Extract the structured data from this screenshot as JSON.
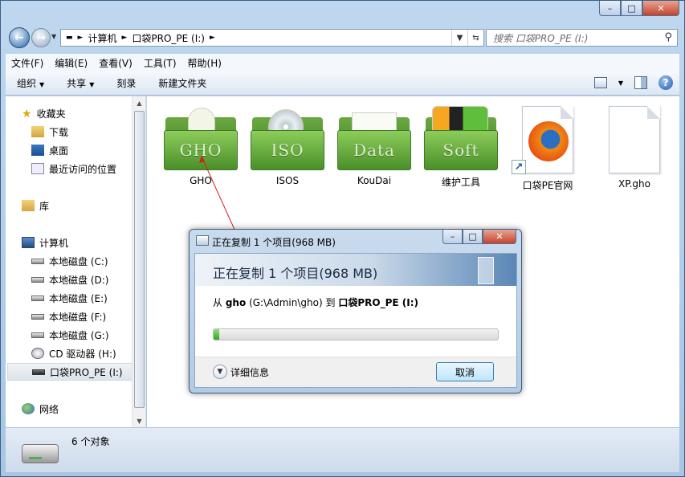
{
  "window": {
    "caption_buttons": [
      "–",
      "□",
      "✕"
    ]
  },
  "address": {
    "crumbs": [
      "计算机",
      "口袋PRO_PE (I:)"
    ],
    "search_placeholder": "搜索 口袋PRO_PE (I:)"
  },
  "menu": [
    "文件(F)",
    "编辑(E)",
    "查看(V)",
    "工具(T)",
    "帮助(H)"
  ],
  "toolbar": {
    "organize": "组织",
    "share": "共享",
    "burn": "刻录",
    "new_folder": "新建文件夹"
  },
  "nav": {
    "favorites": "收藏夹",
    "downloads": "下载",
    "desktop": "桌面",
    "recent": "最近访问的位置",
    "libraries": "库",
    "computer": "计算机",
    "drives": [
      "本地磁盘 (C:)",
      "本地磁盘 (D:)",
      "本地磁盘 (E:)",
      "本地磁盘 (F:)",
      "本地磁盘 (G:)",
      "CD 驱动器 (H:)",
      "口袋PRO_PE (I:)"
    ],
    "network": "网络"
  },
  "files": [
    {
      "name": "GHO",
      "front": "GHO"
    },
    {
      "name": "ISOS",
      "front": "ISO"
    },
    {
      "name": "KouDai",
      "front": "Data"
    },
    {
      "name": "维护工具",
      "front": "Soft"
    },
    {
      "name": "口袋PE官网"
    },
    {
      "name": "XP.gho"
    }
  ],
  "status": {
    "count": "6 个对象"
  },
  "dialog": {
    "title": "正在复制 1 个项目(968 MB)",
    "banner": "正在复制 1 个项目(968 MB)",
    "from_prefix": "从",
    "from_name": "gho",
    "from_path": "(G:\\Admin\\gho)",
    "to_word": "到",
    "to_name": "口袋PRO_PE (I:)",
    "progress": 0.02,
    "more_info": "详细信息",
    "cancel": "取消"
  },
  "colors": {
    "accent": "#3c7fb1",
    "progress_fill": "#2fa51b",
    "folder_green": "#4a8f29"
  }
}
